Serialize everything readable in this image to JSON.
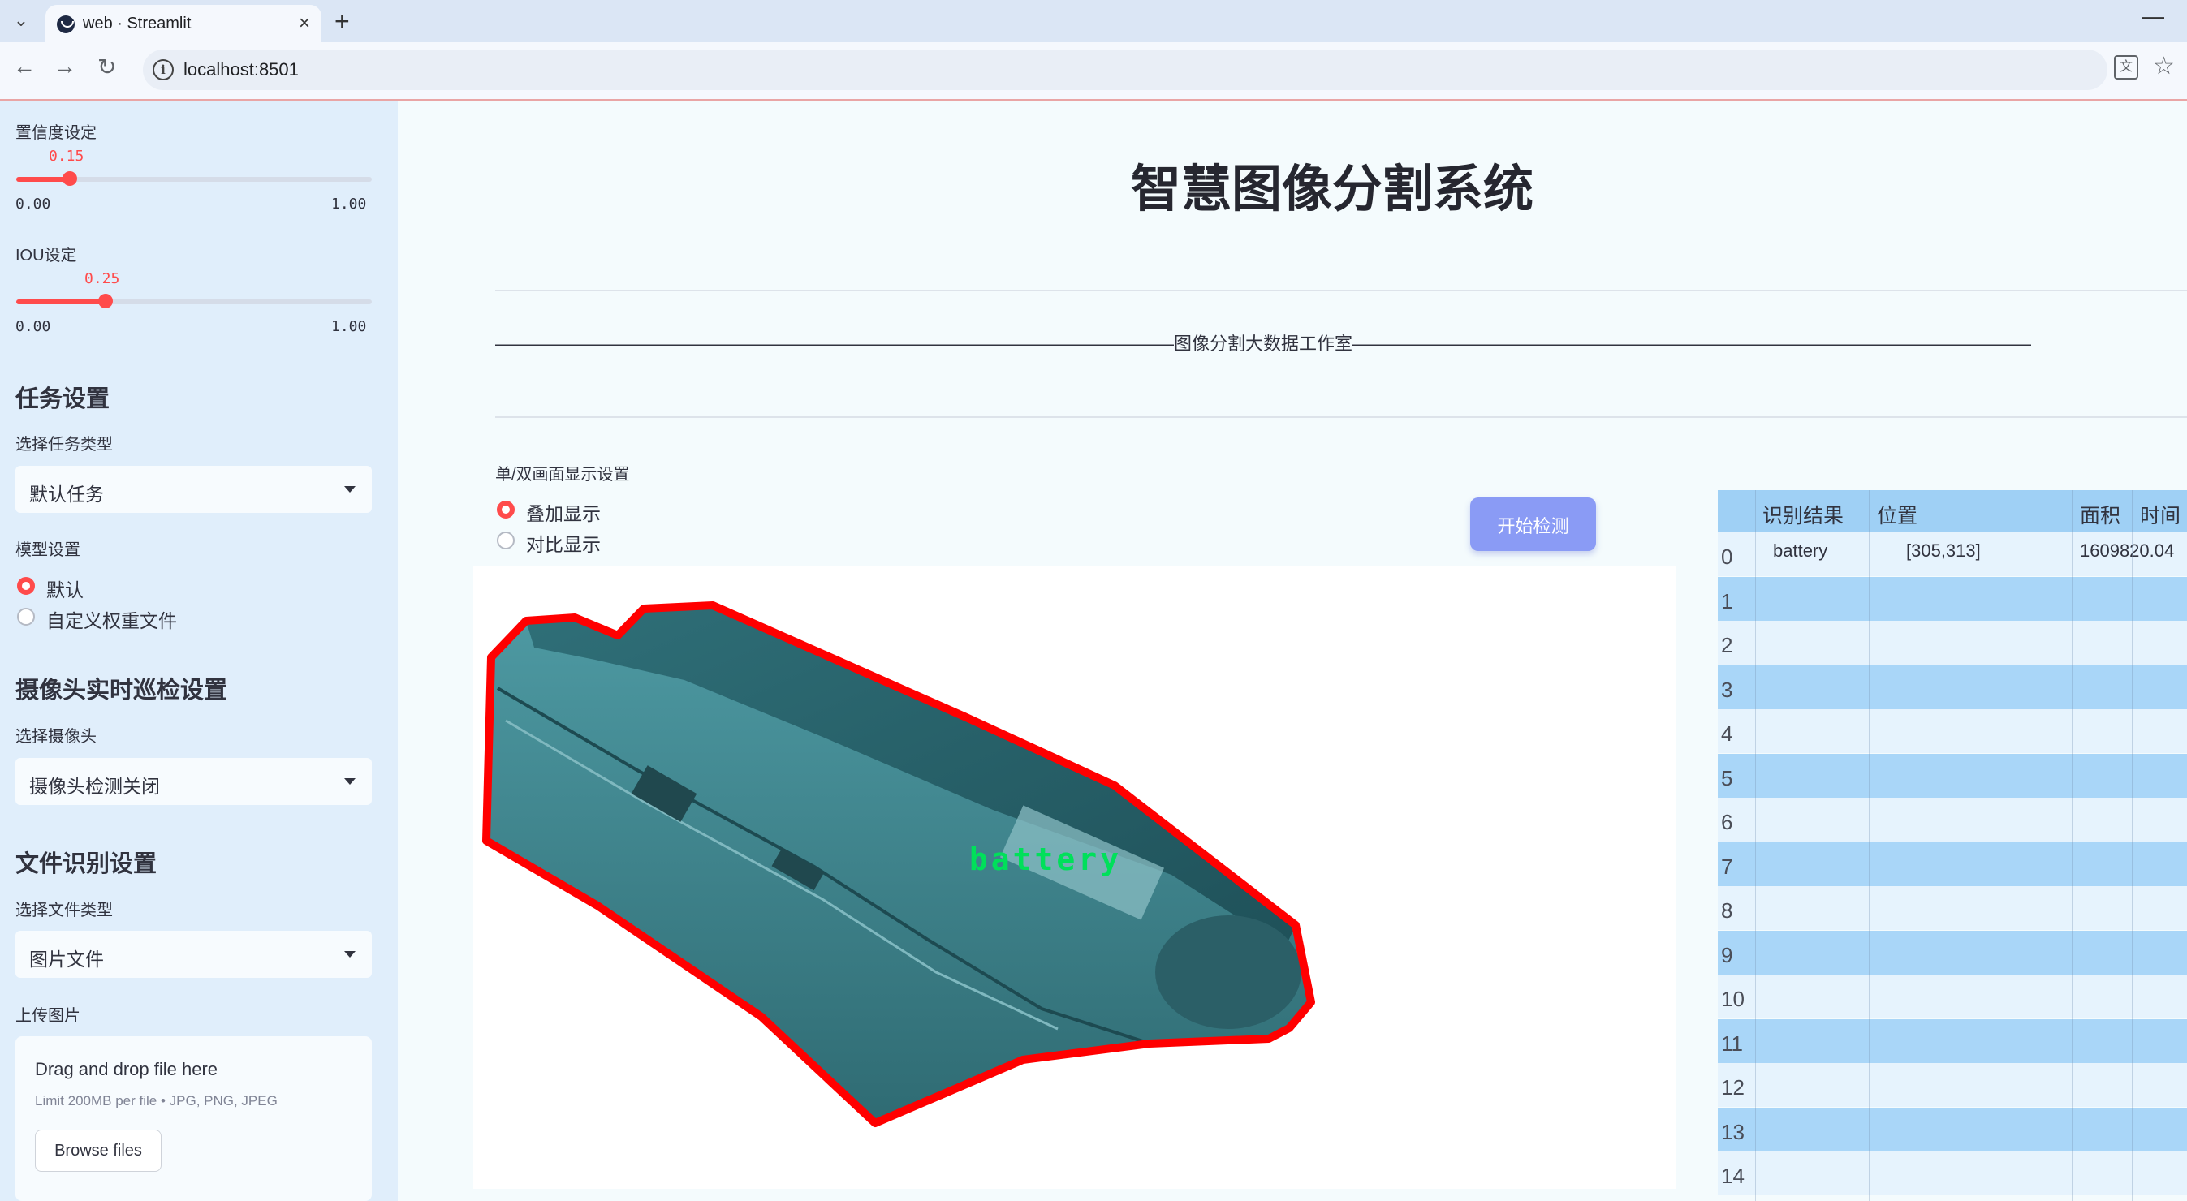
{
  "browser": {
    "tab_title": "web · Streamlit",
    "url": "localhost:8501",
    "new_tab_glyph": "+",
    "close_glyph": "×"
  },
  "sidebar": {
    "confidence": {
      "label": "置信度设定",
      "value": 0.15,
      "value_text": "0.15",
      "min": "0.00",
      "max": "1.00"
    },
    "iou": {
      "label": "IOU设定",
      "value": 0.25,
      "value_text": "0.25",
      "min": "0.00",
      "max": "1.00"
    },
    "task_section": {
      "header": "任务设置",
      "select_label": "选择任务类型",
      "selected": "默认任务"
    },
    "model_section": {
      "label": "模型设置",
      "options": [
        {
          "label": "默认",
          "selected": true
        },
        {
          "label": "自定义权重文件",
          "selected": false
        }
      ]
    },
    "camera_section": {
      "header": "摄像头实时巡检设置",
      "select_label": "选择摄像头",
      "selected": "摄像头检测关闭"
    },
    "file_section": {
      "header": "文件识别设置",
      "select_label": "选择文件类型",
      "selected": "图片文件"
    },
    "upload": {
      "label": "上传图片",
      "drop_title": "Drag and drop file here",
      "limit_text": "Limit 200MB per file • JPG, PNG, JPEG",
      "browse_label": "Browse files"
    }
  },
  "main": {
    "title": "智慧图像分割系统",
    "studio_line": "——————————————————————————————————————图像分割大数据工作室——————————————————————————————————————",
    "display_setting": {
      "label": "单/双画面显示设置",
      "options": [
        {
          "label": "叠加显示",
          "selected": true
        },
        {
          "label": "对比显示",
          "selected": false
        }
      ]
    },
    "start_button": "开始检测",
    "detection_label": "battery"
  },
  "table": {
    "columns": [
      "识别结果",
      "位置",
      "面积",
      "时间"
    ],
    "rows": [
      {
        "index": "0",
        "result": "battery",
        "position": "[305,313]",
        "area": "1609820.04",
        "time": ""
      },
      {
        "index": "1"
      },
      {
        "index": "2"
      },
      {
        "index": "3"
      },
      {
        "index": "4"
      },
      {
        "index": "5"
      },
      {
        "index": "6"
      },
      {
        "index": "7"
      },
      {
        "index": "8"
      },
      {
        "index": "9"
      },
      {
        "index": "10"
      },
      {
        "index": "11"
      },
      {
        "index": "12"
      },
      {
        "index": "13"
      },
      {
        "index": "14"
      }
    ]
  },
  "colors": {
    "accent": "#ff4b4b",
    "sidebar_bg": "#e0eefb",
    "button": "#8a9bf5",
    "table_header": "#9fd0f5",
    "segmentation_outline": "#ff0000",
    "label_text": "#00e05a"
  }
}
